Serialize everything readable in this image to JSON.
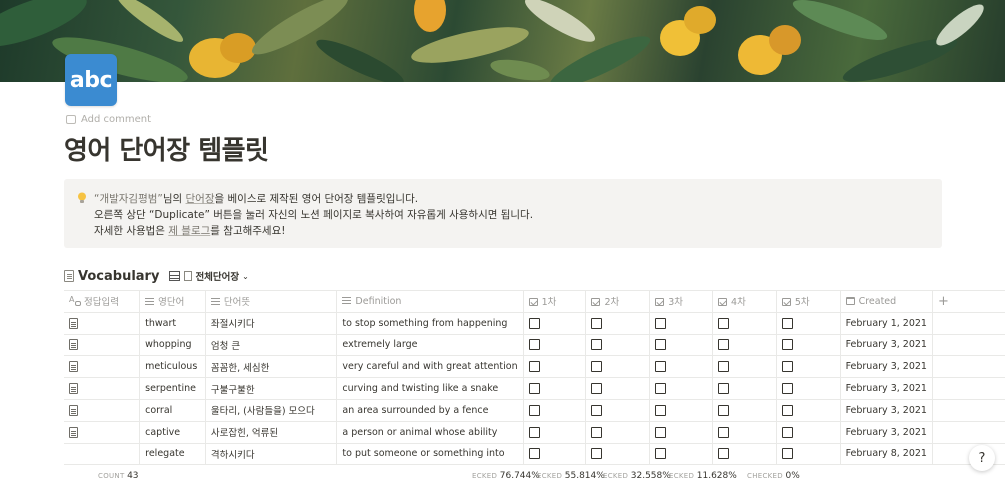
{
  "page": {
    "icon_text": "abc",
    "add_comment": "Add comment",
    "title": "영어 단어장 템플릿"
  },
  "callout": {
    "line1_quote_name": "“개발자김평범”",
    "line1_rest_a": "님의 ",
    "line1_link": "단어장",
    "line1_rest_b": "을 베이스로 제작된 영어 단어장 템플릿입니다.",
    "line2": "오른쪽 상단 “Duplicate” 버튼을 눌러 자신의 노션 페이지로 복사하여 자유롭게 사용하시면 됩니다.",
    "line3_a": "자세한 사용법은 ",
    "line3_link": "제 블로그",
    "line3_b": "를 참고해주세요!"
  },
  "database": {
    "title": "Vocabulary",
    "view_name": "전체단어장",
    "columns": [
      "정답입력",
      "영단어",
      "단어뜻",
      "Definition",
      "1차",
      "2차",
      "3차",
      "4차",
      "5차",
      "Created"
    ],
    "rows": [
      {
        "word": "thwart",
        "meaning": "좌절시키다",
        "definition": "to stop something from happening",
        "created": "February 1, 2021"
      },
      {
        "word": "whopping",
        "meaning": "엄청 큰",
        "definition": "extremely large",
        "created": "February 3, 2021"
      },
      {
        "word": "meticulous",
        "meaning": "꼼꼼한, 세심한",
        "definition": "very careful and with great attention",
        "created": "February 3, 2021"
      },
      {
        "word": "serpentine",
        "meaning": "구불구불한",
        "definition": "curving and twisting like a snake",
        "created": "February 3, 2021"
      },
      {
        "word": "corral",
        "meaning": "울타리, (사람들을) 모으다",
        "definition": "an area surrounded by a fence",
        "created": "February 3, 2021"
      },
      {
        "word": "captive",
        "meaning": "사로잡힌, 억류된",
        "definition": "a person or animal whose ability",
        "created": "February 3, 2021"
      },
      {
        "word": "relegate",
        "meaning": "격하시키다",
        "definition": "to put someone or something into",
        "created": "February 8, 2021"
      }
    ],
    "footer": {
      "count_label": "COUNT",
      "count_value": "43",
      "checked_label": "ECKED",
      "c1": "76.744%",
      "c2": "55.814%",
      "c3": "32.558%",
      "c4": "11.628%",
      "c5_label": "CHECKED",
      "c5": "0%"
    }
  },
  "help_button": "?"
}
